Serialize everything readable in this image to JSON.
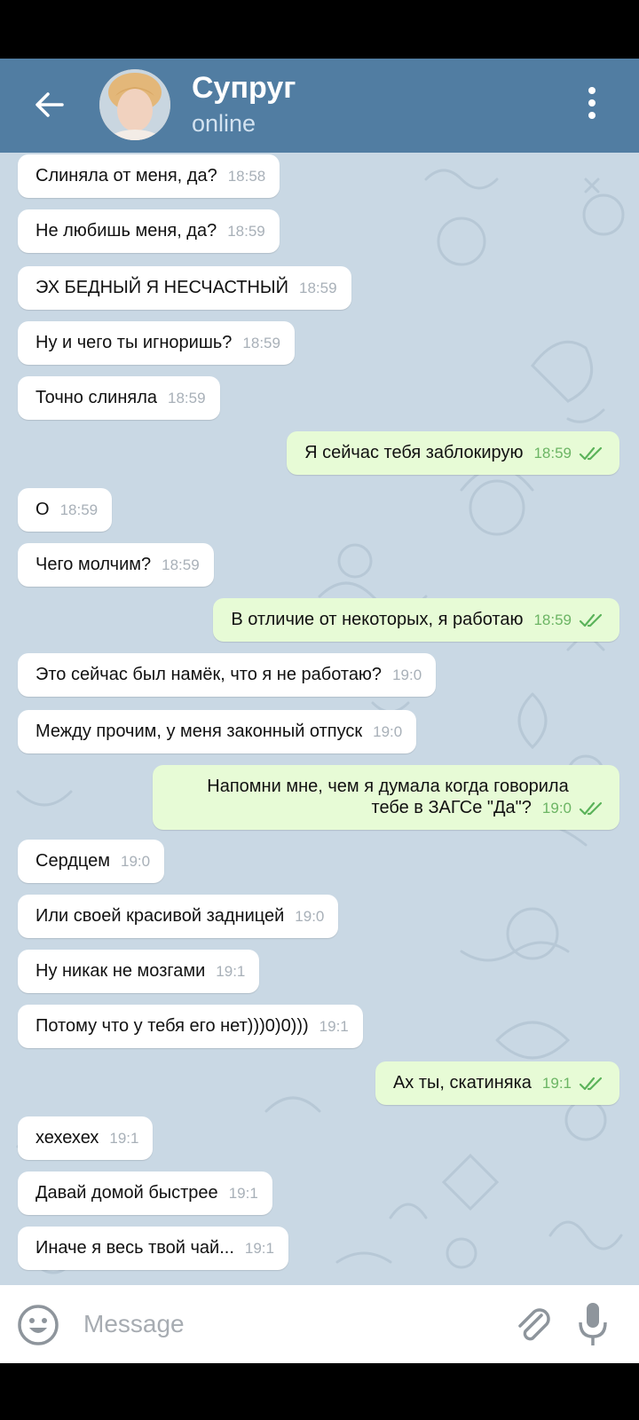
{
  "header": {
    "title": "Супруг",
    "status": "online"
  },
  "composer": {
    "placeholder": "Message"
  },
  "messages": [
    {
      "dir": "in",
      "text": "Слиняла от меня, да?",
      "time": "18:58"
    },
    {
      "dir": "in",
      "text": "Не любишь меня, да?",
      "time": "18:59"
    },
    {
      "dir": "in",
      "text": "ЭХ БЕДНЫЙ Я НЕСЧАСТНЫЙ",
      "time": "18:59"
    },
    {
      "dir": "in",
      "text": "Ну и чего ты игноришь?",
      "time": "18:59"
    },
    {
      "dir": "in",
      "text": "Точно слиняла",
      "time": "18:59"
    },
    {
      "dir": "out",
      "text": "Я сейчас тебя заблокирую",
      "time": "18:59"
    },
    {
      "dir": "in",
      "text": "О",
      "time": "18:59"
    },
    {
      "dir": "in",
      "text": "Чего молчим?",
      "time": "18:59"
    },
    {
      "dir": "out",
      "text": "В отличие от некоторых, я работаю",
      "time": "18:59"
    },
    {
      "dir": "in",
      "text": "Это сейчас был намёк, что я не работаю?",
      "time": "19:0"
    },
    {
      "dir": "in",
      "text": "Между прочим, у меня законный отпуск",
      "time": "19:0"
    },
    {
      "dir": "out",
      "text_line1": "Напомни мне, чем я думала когда говорила",
      "text_line2": "тебе в ЗАГСе \"Да\"?",
      "time": "19:0"
    },
    {
      "dir": "in",
      "text": "Сердцем",
      "time": "19:0"
    },
    {
      "dir": "in",
      "text": "Или своей красивой задницей",
      "time": "19:0"
    },
    {
      "dir": "in",
      "text": "Ну никак не мозгами",
      "time": "19:1"
    },
    {
      "dir": "in",
      "text": "Потому что у тебя его нет)))0)0)))",
      "time": "19:1"
    },
    {
      "dir": "out",
      "text": "Ах ты, скатиняка",
      "time": "19:1"
    },
    {
      "dir": "in",
      "text": "хехехех",
      "time": "19:1"
    },
    {
      "dir": "in",
      "text": "Давай домой быстрее",
      "time": "19:1"
    },
    {
      "dir": "in",
      "text": "Иначе я весь твой чай...",
      "time": "19:1"
    }
  ]
}
